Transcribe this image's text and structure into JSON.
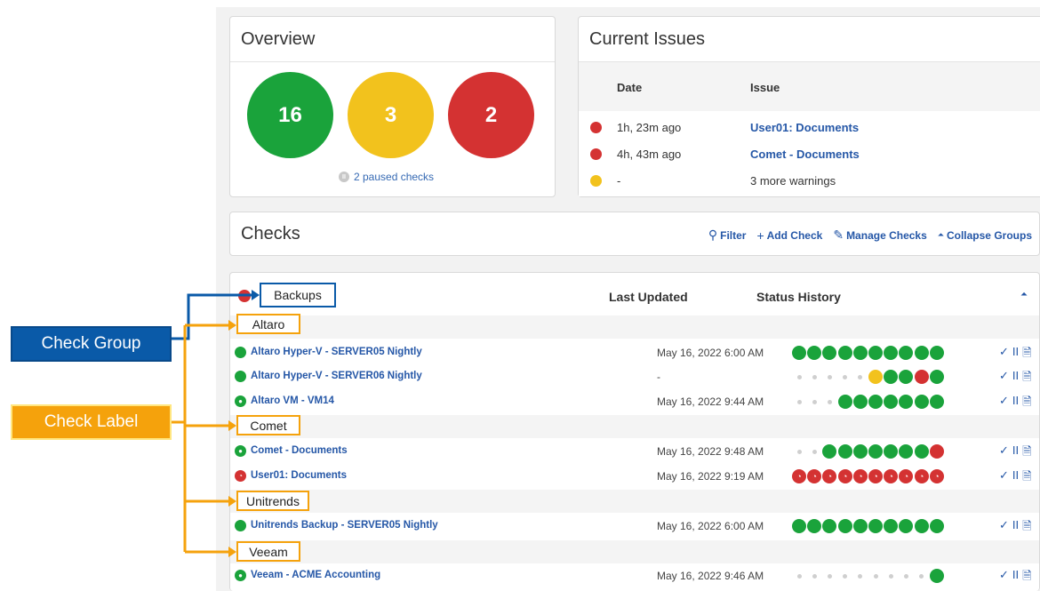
{
  "colors": {
    "green": "#1aa33b",
    "yellow": "#f2c21d",
    "red": "#d43232",
    "grey": "#cfcfcf",
    "link": "#2557a7"
  },
  "overview": {
    "title": "Overview",
    "ok_count": "16",
    "warn_count": "3",
    "err_count": "2",
    "paused_label": "2 paused checks",
    "paused_icon": "pause-icon"
  },
  "issues": {
    "title": "Current Issues",
    "col_date": "Date",
    "col_issue": "Issue",
    "rows": [
      {
        "status": "red-clock",
        "date": "1h, 23m ago",
        "issue": "User01: Documents",
        "link": true
      },
      {
        "status": "red",
        "date": "4h, 43m ago",
        "issue": "Comet - Documents",
        "link": true
      },
      {
        "status": "yellow",
        "date": "-",
        "issue": "3 more warnings",
        "link": false
      }
    ]
  },
  "checks": {
    "title": "Checks",
    "actions": [
      {
        "icon": "search-icon",
        "label": "Filter"
      },
      {
        "icon": "plus-icon",
        "label": "Add Check"
      },
      {
        "icon": "pencil-icon",
        "label": "Manage Checks"
      },
      {
        "icon": "caret-up-icon",
        "label": "Collapse Groups"
      }
    ]
  },
  "table": {
    "group_name": "Backups",
    "col_updated": "Last Updated",
    "col_history": "Status History",
    "labels": [
      "Altaro",
      "Comet",
      "Unitrends",
      "Veeam"
    ],
    "rows": [
      {
        "name": "Altaro Hyper-V - SERVER05 Nightly",
        "updated": "May 16, 2022 6:00 AM",
        "icon": "green",
        "history": [
          "g",
          "g",
          "g",
          "g",
          "g",
          "g",
          "g",
          "g",
          "g",
          "g"
        ]
      },
      {
        "name": "Altaro Hyper-V - SERVER06 Nightly",
        "updated": "-",
        "icon": "green",
        "history": [
          "x",
          "x",
          "x",
          "x",
          "x",
          "y",
          "g",
          "g",
          "r",
          "g"
        ]
      },
      {
        "name": "Altaro VM - VM14",
        "updated": "May 16, 2022 9:44 AM",
        "icon": "green-person",
        "history": [
          "x",
          "x",
          "x",
          "g",
          "g",
          "g",
          "g",
          "g",
          "g",
          "g"
        ]
      },
      {
        "name": "Comet - Documents",
        "updated": "May 16, 2022 9:48 AM",
        "icon": "green-person",
        "history": [
          "x",
          "x",
          "g",
          "g",
          "g",
          "g",
          "g",
          "g",
          "g",
          "r"
        ]
      },
      {
        "name": "User01: Documents",
        "updated": "May 16, 2022 9:19 AM",
        "icon": "red-clock",
        "history": [
          "rc",
          "rc",
          "rc",
          "rc",
          "rc",
          "rc",
          "rc",
          "rc",
          "rc",
          "rc"
        ]
      },
      {
        "name": "Unitrends Backup - SERVER05 Nightly",
        "updated": "May 16, 2022 6:00 AM",
        "icon": "green",
        "history": [
          "g",
          "g",
          "g",
          "g",
          "g",
          "g",
          "g",
          "g",
          "g",
          "g"
        ]
      },
      {
        "name": "Veeam - ACME Accounting",
        "updated": "May 16, 2022 9:46 AM",
        "icon": "green-person",
        "history": [
          "x",
          "x",
          "x",
          "x",
          "x",
          "x",
          "x",
          "x",
          "x",
          "g"
        ]
      }
    ],
    "row_actions": [
      "✓",
      "II",
      "🗎"
    ]
  },
  "annotations": {
    "check_group": "Check Group",
    "check_label": "Check Label",
    "check_group_color": "#0a5aa8",
    "check_label_color": "#f5a20c"
  }
}
